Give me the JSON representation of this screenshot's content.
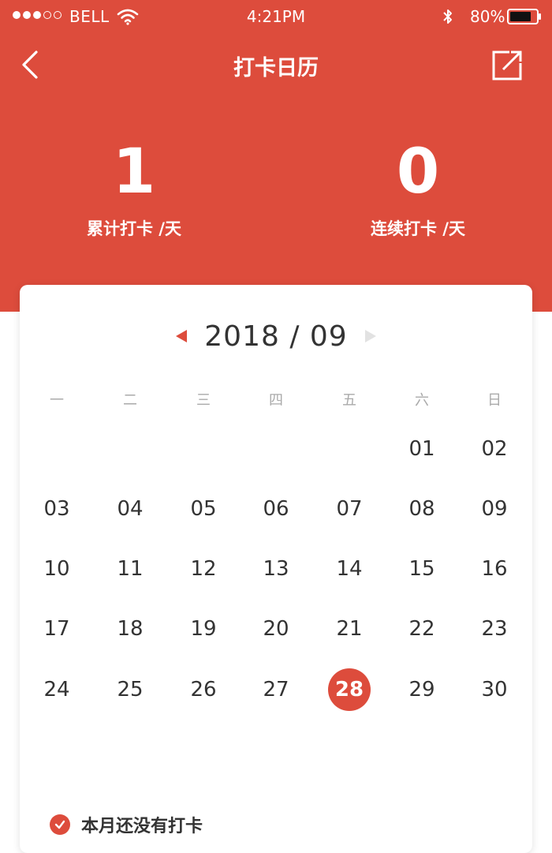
{
  "status_bar": {
    "carrier": "BELL",
    "time": "4:21PM",
    "battery": "80%",
    "battery_level": 0.8
  },
  "nav": {
    "title": "打卡日历"
  },
  "stats": {
    "total": {
      "value": "1",
      "label": "累计打卡 /天"
    },
    "streak": {
      "value": "0",
      "label": "连续打卡 /天"
    }
  },
  "calendar": {
    "month": "2018 / 09",
    "weekdays": [
      "一",
      "二",
      "三",
      "四",
      "五",
      "六",
      "日"
    ],
    "first_weekday_index": 5,
    "days": [
      "01",
      "02",
      "03",
      "04",
      "05",
      "06",
      "07",
      "08",
      "09",
      "10",
      "11",
      "12",
      "13",
      "14",
      "15",
      "16",
      "17",
      "18",
      "19",
      "20",
      "21",
      "22",
      "23",
      "24",
      "25",
      "26",
      "27",
      "28",
      "29",
      "30"
    ],
    "selected": "28"
  },
  "footer": {
    "note": "本月还没有打卡"
  },
  "colors": {
    "accent": "#DD4C3C",
    "text": "#333333",
    "weekday": "#aaaaaa"
  },
  "icons": {
    "back": "chevron-left-icon",
    "edit": "edit-icon",
    "prev_month": "triangle-left-icon",
    "next_month": "triangle-right-icon",
    "check": "check-circle-icon"
  }
}
